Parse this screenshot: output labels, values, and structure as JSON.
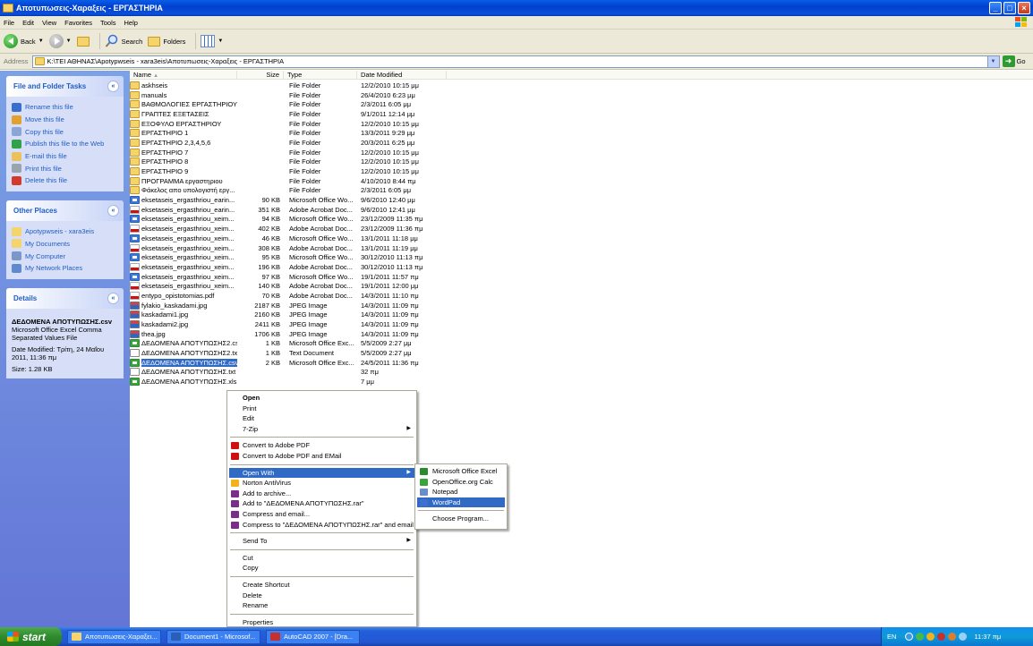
{
  "window": {
    "title": "Αποτυπωσεις-Χαραξεις - ΕΡΓΑΣΤΗΡΙΑ",
    "controls": [
      "minimize",
      "maximize",
      "close"
    ]
  },
  "menu": [
    "File",
    "Edit",
    "View",
    "Favorites",
    "Tools",
    "Help"
  ],
  "toolbar": {
    "back_label": "Back",
    "search_label": "Search",
    "folders_label": "Folders"
  },
  "address": {
    "label": "Address",
    "path": "K:\\ΤΕΙ ΑΘΗΝΑΣ\\Apotypwseis - xara3eis\\Αποτυπωσεις-Χαραξεις - ΕΡΓΑΣΤΗΡΙΑ",
    "go_label": "Go"
  },
  "tasks_panel": {
    "title": "File and Folder Tasks",
    "items": [
      {
        "label": "Rename this file",
        "icon": "rename-icon",
        "color": "#3a6fd0"
      },
      {
        "label": "Move this file",
        "icon": "move-icon",
        "color": "#e2a12d"
      },
      {
        "label": "Copy this file",
        "icon": "copy-icon",
        "color": "#8aa5d6"
      },
      {
        "label": "Publish this file to the Web",
        "icon": "globe-icon",
        "color": "#2fa24a"
      },
      {
        "label": "E-mail this file",
        "icon": "email-icon",
        "color": "#e8c25a"
      },
      {
        "label": "Print this file",
        "icon": "print-icon",
        "color": "#9aa4b0"
      },
      {
        "label": "Delete this file",
        "icon": "delete-icon",
        "color": "#d33a2c"
      }
    ]
  },
  "places_panel": {
    "title": "Other Places",
    "items": [
      {
        "label": "Apotypwseis - xara3eis",
        "icon": "folder-icon",
        "color": "#f5d46b"
      },
      {
        "label": "My Documents",
        "icon": "my-documents-icon",
        "color": "#f5d46b"
      },
      {
        "label": "My Computer",
        "icon": "my-computer-icon",
        "color": "#7b98c8"
      },
      {
        "label": "My Network Places",
        "icon": "network-icon",
        "color": "#5f8ad0"
      }
    ]
  },
  "details_panel": {
    "title": "Details",
    "filename": "ΔΕΔΟΜΕΝΑ ΑΠΟΤΥΠΩΣΗΣ.csv",
    "filetype": "Microsoft Office Excel Comma Separated Values File",
    "modified": "Date Modified: Τρίτη, 24 Μαΐου 2011, 11:36 πμ",
    "size": "Size: 1.28 KB"
  },
  "columns": {
    "name": "Name",
    "size": "Size",
    "type": "Type",
    "date": "Date Modified"
  },
  "files": [
    {
      "name": "askhseis",
      "size": "",
      "type": "File Folder",
      "date": "12/2/2010 10:15 μμ",
      "kind": "folder"
    },
    {
      "name": "manuals",
      "size": "",
      "type": "File Folder",
      "date": "26/4/2010 6:23 μμ",
      "kind": "folder"
    },
    {
      "name": "ΒΑΘΜΟΛΟΓΙΕΣ ΕΡΓΑΣΤΗΡΙΟΥ",
      "size": "",
      "type": "File Folder",
      "date": "2/3/2011 6:05 μμ",
      "kind": "folder"
    },
    {
      "name": "ΓΡΑΠΤΕΣ ΕΞΕΤΑΣΕΙΣ",
      "size": "",
      "type": "File Folder",
      "date": "9/1/2011 12:14 μμ",
      "kind": "folder"
    },
    {
      "name": "ΕΞΟΦΥΛΟ ΕΡΓΑΣΤΗΡΙΟΥ",
      "size": "",
      "type": "File Folder",
      "date": "12/2/2010 10:15 μμ",
      "kind": "folder"
    },
    {
      "name": "ΕΡΓΑΣΤΗΡΙΟ 1",
      "size": "",
      "type": "File Folder",
      "date": "13/3/2011 9:29 μμ",
      "kind": "folder"
    },
    {
      "name": "ΕΡΓΑΣΤΗΡΙΟ 2,3,4,5,6",
      "size": "",
      "type": "File Folder",
      "date": "20/3/2011 6:25 μμ",
      "kind": "folder"
    },
    {
      "name": "ΕΡΓΑΣΤΗΡΙΟ 7",
      "size": "",
      "type": "File Folder",
      "date": "12/2/2010 10:15 μμ",
      "kind": "folder"
    },
    {
      "name": "ΕΡΓΑΣΤΗΡΙΟ 8",
      "size": "",
      "type": "File Folder",
      "date": "12/2/2010 10:15 μμ",
      "kind": "folder"
    },
    {
      "name": "ΕΡΓΑΣΤΗΡΙΟ 9",
      "size": "",
      "type": "File Folder",
      "date": "12/2/2010 10:15 μμ",
      "kind": "folder"
    },
    {
      "name": "ΠΡΟΓΡΑΜΜΑ εργαστηριου",
      "size": "",
      "type": "File Folder",
      "date": "4/10/2010 8:44 πμ",
      "kind": "folder"
    },
    {
      "name": "Φάκελος απο υπολογιστή εργ...",
      "size": "",
      "type": "File Folder",
      "date": "2/3/2011 6:05 μμ",
      "kind": "folder"
    },
    {
      "name": "eksetaseis_ergasthriou_earin...",
      "size": "90 KB",
      "type": "Microsoft Office Wo...",
      "date": "9/6/2010 12:40 μμ",
      "kind": "word"
    },
    {
      "name": "eksetaseis_ergasthriou_earin...",
      "size": "351 KB",
      "type": "Adobe Acrobat Doc...",
      "date": "9/6/2010 12:41 μμ",
      "kind": "pdf"
    },
    {
      "name": "eksetaseis_ergasthriou_xeim...",
      "size": "94 KB",
      "type": "Microsoft Office Wo...",
      "date": "23/12/2009 11:35 πμ",
      "kind": "word"
    },
    {
      "name": "eksetaseis_ergasthriou_xeim...",
      "size": "402 KB",
      "type": "Adobe Acrobat Doc...",
      "date": "23/12/2009 11:36 πμ",
      "kind": "pdf"
    },
    {
      "name": "eksetaseis_ergasthriou_xeim...",
      "size": "46 KB",
      "type": "Microsoft Office Wo...",
      "date": "13/1/2011 11:18 μμ",
      "kind": "word"
    },
    {
      "name": "eksetaseis_ergasthriou_xeim...",
      "size": "308 KB",
      "type": "Adobe Acrobat Doc...",
      "date": "13/1/2011 11:19 μμ",
      "kind": "pdf"
    },
    {
      "name": "eksetaseis_ergasthriou_xeim...",
      "size": "95 KB",
      "type": "Microsoft Office Wo...",
      "date": "30/12/2010 11:13 πμ",
      "kind": "word"
    },
    {
      "name": "eksetaseis_ergasthriou_xeim...",
      "size": "196 KB",
      "type": "Adobe Acrobat Doc...",
      "date": "30/12/2010 11:13 πμ",
      "kind": "pdf"
    },
    {
      "name": "eksetaseis_ergasthriou_xeim...",
      "size": "97 KB",
      "type": "Microsoft Office Wo...",
      "date": "19/1/2011 11:57 πμ",
      "kind": "word"
    },
    {
      "name": "eksetaseis_ergasthriou_xeim...",
      "size": "140 KB",
      "type": "Adobe Acrobat Doc...",
      "date": "19/1/2011 12:00 μμ",
      "kind": "pdf"
    },
    {
      "name": "entypo_opistotomias.pdf",
      "size": "70 KB",
      "type": "Adobe Acrobat Doc...",
      "date": "14/3/2011 11:10 πμ",
      "kind": "pdf"
    },
    {
      "name": "fylakio_kaskadami.jpg",
      "size": "2187 KB",
      "type": "JPEG Image",
      "date": "14/3/2011 11:09 πμ",
      "kind": "jpg"
    },
    {
      "name": "kaskadami1.jpg",
      "size": "2160 KB",
      "type": "JPEG Image",
      "date": "14/3/2011 11:09 πμ",
      "kind": "jpg"
    },
    {
      "name": "kaskadami2.jpg",
      "size": "2411 KB",
      "type": "JPEG Image",
      "date": "14/3/2011 11:09 πμ",
      "kind": "jpg"
    },
    {
      "name": "thea.jpg",
      "size": "1706 KB",
      "type": "JPEG Image",
      "date": "14/3/2011 11:09 πμ",
      "kind": "jpg"
    },
    {
      "name": "ΔΕΔΟΜΕΝΑ ΑΠΟΤΥΠΩΣΗΣ2.csv",
      "size": "1 KB",
      "type": "Microsoft Office Exc...",
      "date": "5/5/2009 2:27 μμ",
      "kind": "excel"
    },
    {
      "name": "ΔΕΔΟΜΕΝΑ ΑΠΟΤΥΠΩΣΗΣ2.txt",
      "size": "1 KB",
      "type": "Text Document",
      "date": "5/5/2009 2:27 μμ",
      "kind": "txt"
    },
    {
      "name": "ΔΕΔΟΜΕΝΑ ΑΠΟΤΥΠΩΣΗΣ.csv",
      "size": "2 KB",
      "type": "Microsoft Office Exc...",
      "date": "24/5/2011 11:36 πμ",
      "kind": "excel",
      "selected": true
    },
    {
      "name": "ΔΕΔΟΜΕΝΑ ΑΠΟΤΥΠΩΣΗΣ.txt",
      "size": "",
      "type": "",
      "date": "32 πμ",
      "kind": "txt"
    },
    {
      "name": "ΔΕΔΟΜΕΝΑ ΑΠΟΤΥΠΩΣΗΣ.xls",
      "size": "",
      "type": "",
      "date": "7 μμ",
      "kind": "excel"
    }
  ],
  "context_menu": {
    "items": [
      {
        "label": "Open",
        "bold": true
      },
      {
        "label": "Print"
      },
      {
        "label": "Edit"
      },
      {
        "label": "7-Zip",
        "submenu": true
      },
      {
        "sep": true
      },
      {
        "label": "Convert to Adobe PDF",
        "icon": "adobe-pdf-icon",
        "color": "#d01010"
      },
      {
        "label": "Convert to Adobe PDF and EMail",
        "icon": "adobe-pdf-email-icon",
        "color": "#d01010"
      },
      {
        "sep": true
      },
      {
        "label": "Open With",
        "submenu": true,
        "highlight": true
      },
      {
        "label": "Norton AntiVirus",
        "icon": "norton-icon",
        "color": "#f2b21a"
      },
      {
        "label": "Add to archive...",
        "icon": "winrar-icon",
        "color": "#7a2d8a"
      },
      {
        "label": "Add to \"ΔΕΔΟΜΕΝΑ ΑΠΟΤΥΠΩΣΗΣ.rar\"",
        "icon": "winrar-icon",
        "color": "#7a2d8a"
      },
      {
        "label": "Compress and email...",
        "icon": "winrar-icon",
        "color": "#7a2d8a"
      },
      {
        "label": "Compress to \"ΔΕΔΟΜΕΝΑ ΑΠΟΤΥΠΩΣΗΣ.rar\" and email",
        "icon": "winrar-icon",
        "color": "#7a2d8a"
      },
      {
        "sep": true
      },
      {
        "label": "Send To",
        "submenu": true
      },
      {
        "sep": true
      },
      {
        "label": "Cut"
      },
      {
        "label": "Copy"
      },
      {
        "sep": true
      },
      {
        "label": "Create Shortcut"
      },
      {
        "label": "Delete"
      },
      {
        "label": "Rename"
      },
      {
        "sep": true
      },
      {
        "label": "Properties"
      }
    ]
  },
  "open_with_submenu": {
    "items": [
      {
        "label": "Microsoft Office Excel",
        "icon": "excel-icon",
        "color": "#2b8a2b"
      },
      {
        "label": "OpenOffice.org Calc",
        "icon": "calc-icon",
        "color": "#3aa33a"
      },
      {
        "label": "Notepad",
        "icon": "notepad-icon",
        "color": "#6a8cc7"
      },
      {
        "label": "WordPad",
        "icon": "wordpad-icon",
        "color": "#3c6fd0",
        "highlight": true
      },
      {
        "sep": true
      },
      {
        "label": "Choose Program..."
      }
    ]
  },
  "taskbar": {
    "start_label": "start",
    "buttons": [
      {
        "label": "Αποτυπωσεις-Χαραξει...",
        "icon": "folder-icon",
        "color": "#f5d46b"
      },
      {
        "label": "Document1 - Microsof...",
        "icon": "word-icon",
        "color": "#2a5fb8"
      },
      {
        "label": "AutoCAD 2007 - [Dra...",
        "icon": "autocad-icon",
        "color": "#c53030"
      }
    ],
    "lang": "EN",
    "clock": "11:37 πμ"
  }
}
